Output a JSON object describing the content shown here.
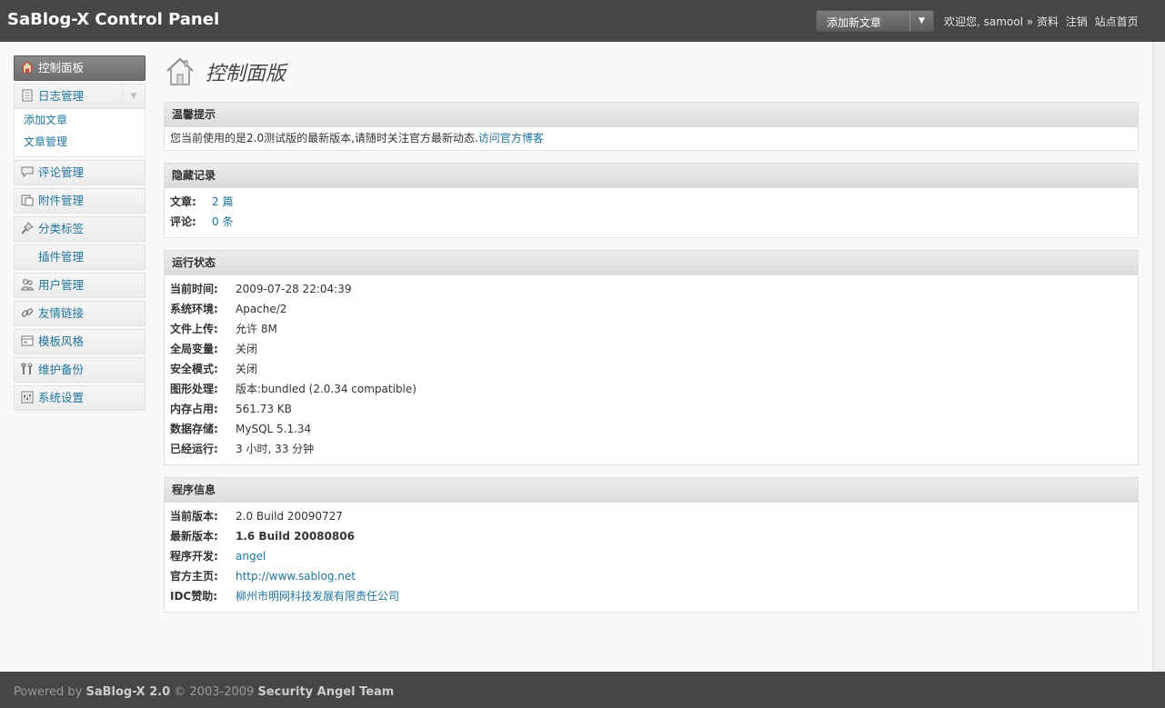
{
  "header": {
    "title": "SaBlog-X Control Panel",
    "quick_action": "添加新文章",
    "welcome": "欢迎您, samool »",
    "links": [
      "资料",
      "注销",
      "站点首页"
    ]
  },
  "sidebar": {
    "dashboard": "控制面板",
    "posts": {
      "label": "日志管理",
      "sub": [
        "添加文章",
        "文章管理"
      ]
    },
    "items": [
      {
        "label": "评论管理",
        "icon": "comment-icon"
      },
      {
        "label": "附件管理",
        "icon": "attachment-icon"
      },
      {
        "label": "分类标签",
        "icon": "pin-icon"
      },
      {
        "label": "插件管理",
        "icon": ""
      },
      {
        "label": "用户管理",
        "icon": "users-icon"
      },
      {
        "label": "友情链接",
        "icon": "link-icon"
      },
      {
        "label": "模板风格",
        "icon": "template-icon"
      },
      {
        "label": "维护备份",
        "icon": "tools-icon"
      },
      {
        "label": "系统设置",
        "icon": "settings-icon"
      }
    ]
  },
  "page": {
    "title": "控制面版"
  },
  "notice": {
    "title": "温馨提示",
    "text": "您当前使用的是2.0测试版的最新版本,请随时关注官方最新动态.",
    "link": "访问官方博客"
  },
  "hidden": {
    "title": "隐藏记录",
    "rows": [
      {
        "k": "文章:",
        "v": "2 篇"
      },
      {
        "k": "评论:",
        "v": "0 条"
      }
    ]
  },
  "status": {
    "title": "运行状态",
    "rows": [
      {
        "k": "当前时间:",
        "v": "2009-07-28 22:04:39"
      },
      {
        "k": "系统环境:",
        "v": "Apache/2"
      },
      {
        "k": "文件上传:",
        "v": "允许 8M"
      },
      {
        "k": "全局变量:",
        "v": "关闭"
      },
      {
        "k": "安全模式:",
        "v": "关闭"
      },
      {
        "k": "图形处理:",
        "v": "版本:bundled (2.0.34 compatible)"
      },
      {
        "k": "内存占用:",
        "v": "561.73 KB"
      },
      {
        "k": "数据存储:",
        "v": "MySQL 5.1.34"
      },
      {
        "k": "已经运行:",
        "v": "3 小时, 33 分钟"
      }
    ]
  },
  "program": {
    "title": "程序信息",
    "rows": [
      {
        "k": "当前版本:",
        "v": "2.0 Build 20090727"
      },
      {
        "k": "最新版本:",
        "v": "1.6 Build 20080806"
      },
      {
        "k": "程序开发:",
        "v": "angel"
      },
      {
        "k": "官方主页:",
        "v": "http://www.sablog.net"
      },
      {
        "k": "IDC赞助:",
        "v": "柳州市明网科技发展有限责任公司"
      }
    ]
  },
  "footer": {
    "powered": "Powered by",
    "product": "SaBlog-X 2.0",
    "copy": "© 2003-2009",
    "team": "Security Angel Team"
  }
}
